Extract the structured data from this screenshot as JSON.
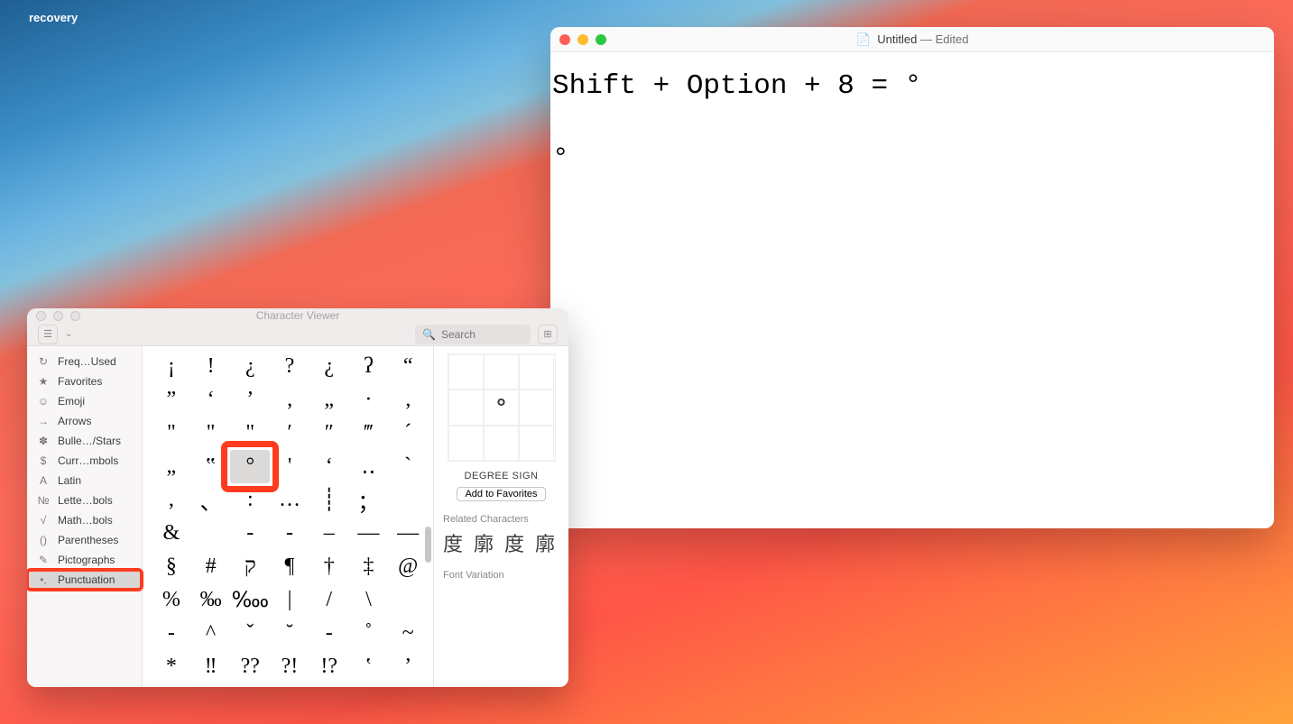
{
  "desktop_label": "recovery",
  "textedit": {
    "title_name": "Untitled",
    "title_status": "Edited",
    "content": "Shift + Option + 8 = °\n\n°"
  },
  "charviewer": {
    "title": "Character Viewer",
    "search_placeholder": "Search",
    "sidebar": [
      {
        "icon": "↻",
        "label": "Freq…Used"
      },
      {
        "icon": "★",
        "label": "Favorites"
      },
      {
        "icon": "☺",
        "label": "Emoji"
      },
      {
        "icon": "→",
        "label": "Arrows"
      },
      {
        "icon": "✽",
        "label": "Bulle…/Stars"
      },
      {
        "icon": "$",
        "label": "Curr…mbols"
      },
      {
        "icon": "A",
        "label": "Latin"
      },
      {
        "icon": "№",
        "label": "Lette…bols"
      },
      {
        "icon": "√",
        "label": "Math…bols"
      },
      {
        "icon": "()",
        "label": "Parentheses"
      },
      {
        "icon": "✎",
        "label": "Pictographs"
      },
      {
        "icon": "•,",
        "label": "Punctuation"
      }
    ],
    "selected_sidebar_index": 11,
    "grid": [
      [
        "¡",
        "!",
        "¿",
        "?",
        "¿",
        "ʔ",
        "“"
      ],
      [
        "”",
        "‘",
        "’",
        "‚",
        "„",
        "·",
        "‚"
      ],
      [
        "\"",
        "\"",
        "\"",
        "′",
        "″",
        "‴",
        "´"
      ],
      [
        "„",
        "‟",
        "°",
        "'",
        "‘",
        "‥",
        "`"
      ],
      [
        ",",
        "、",
        ":",
        "…",
        "┊",
        "；",
        ""
      ],
      [
        "&",
        "",
        "‑",
        "-",
        "–",
        "—",
        "―"
      ],
      [
        "§",
        "#",
        "ק",
        "¶",
        "†",
        "‡",
        "@"
      ],
      [
        "%",
        "‰",
        "‱",
        "|",
        "/",
        "\\",
        ""
      ],
      [
        "-",
        "^",
        "ˇ",
        "˘",
        "-",
        "˚",
        "~"
      ],
      [
        "*",
        "‼",
        "??",
        "?!",
        "!?",
        "‛",
        "’"
      ]
    ],
    "selected_cell": {
      "row": 3,
      "col": 2
    },
    "detail": {
      "glyph": "°",
      "name": "DEGREE SIGN",
      "fav_button": "Add to Favorites",
      "related_label": "Related Characters",
      "related": [
        "度",
        "廓",
        "度",
        "廓"
      ],
      "font_variation_label": "Font Variation"
    }
  }
}
